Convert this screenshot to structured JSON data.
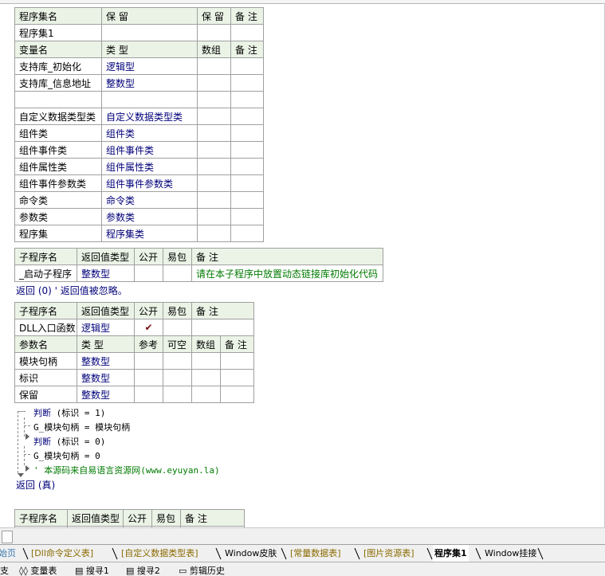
{
  "assembly_table": {
    "headers": [
      "程序集名",
      "保 留",
      "保 留",
      "备 注"
    ],
    "row": {
      "name": "程序集1",
      "c2": "",
      "c3": "",
      "c4": ""
    }
  },
  "variable_table": {
    "headers": [
      "变量名",
      "类 型",
      "数组",
      "备 注"
    ],
    "rows": [
      {
        "name": "支持库_初始化",
        "type": "逻辑型"
      },
      {
        "name": "支持库_信息地址",
        "type": "整数型"
      },
      {
        "name": "",
        "type": ""
      },
      {
        "name": "自定义数据类型类",
        "type": "自定义数据类型类"
      },
      {
        "name": "组件类",
        "type": "组件类"
      },
      {
        "name": "组件事件类",
        "type": "组件事件类"
      },
      {
        "name": "组件属性类",
        "type": "组件属性类"
      },
      {
        "name": "组件事件参数类",
        "type": "组件事件参数类"
      },
      {
        "name": "命令类",
        "type": "命令类"
      },
      {
        "name": "参数类",
        "type": "参数类"
      },
      {
        "name": "程序集",
        "type": "程序集类"
      }
    ]
  },
  "sub1": {
    "headers": [
      "子程序名",
      "返回值类型",
      "公开",
      "易包",
      "备 注"
    ],
    "name": "_启动子程序",
    "return_type": "整数型",
    "remark": "请在本子程序中放置动态链接库初始化代码",
    "code": "返回 (0) ' 返回值被忽略。"
  },
  "sub2": {
    "headers": [
      "子程序名",
      "返回值类型",
      "公开",
      "易包",
      "备 注"
    ],
    "name": "DLL入口函数",
    "return_type": "逻辑型",
    "public_mark": "✔",
    "param_headers": [
      "参数名",
      "类 型",
      "参考",
      "可空",
      "数组",
      "备 注"
    ],
    "params": [
      {
        "name": "模块句柄",
        "type": "整数型"
      },
      {
        "name": "标识",
        "type": "整数型"
      },
      {
        "name": "保留",
        "type": "整数型"
      }
    ],
    "code": {
      "if1_kw": "判断",
      "if1_cond": "(标识 = 1)",
      "assign1": "G_模块句柄 = 模块句柄",
      "if2_kw": "判断",
      "if2_cond": "(标识 = 0)",
      "assign2": "G_模块句柄 = 0",
      "comment": "' 本源码来自易语言资源网(www.eyuyan.la)",
      "ret": "返回 (真)"
    }
  },
  "sub3": {
    "headers": [
      "子程序名",
      "返回值类型",
      "公开",
      "易包",
      "备 注"
    ]
  },
  "tabs": [
    {
      "label": "始页",
      "active": false,
      "color": "#3a7ab0"
    },
    {
      "label": "[Dll命令定义表]",
      "active": false,
      "color": "#8a6a00"
    },
    {
      "label": "[自定义数据类型表]",
      "active": false,
      "color": "#8a6a00"
    },
    {
      "label": "Window皮肤",
      "active": false,
      "color": "#000000"
    },
    {
      "label": "[常量数据表]",
      "active": false,
      "color": "#8a6a00"
    },
    {
      "label": "[图片资源表]",
      "active": false,
      "color": "#8a6a00"
    },
    {
      "label": "程序集1",
      "active": true,
      "color": "#000000"
    },
    {
      "label": "Window挂接",
      "active": false,
      "color": "#000000"
    }
  ],
  "bottom_tabs": [
    "支",
    "变量表",
    "搜寻1",
    "搜寻2",
    "剪辑历史"
  ]
}
